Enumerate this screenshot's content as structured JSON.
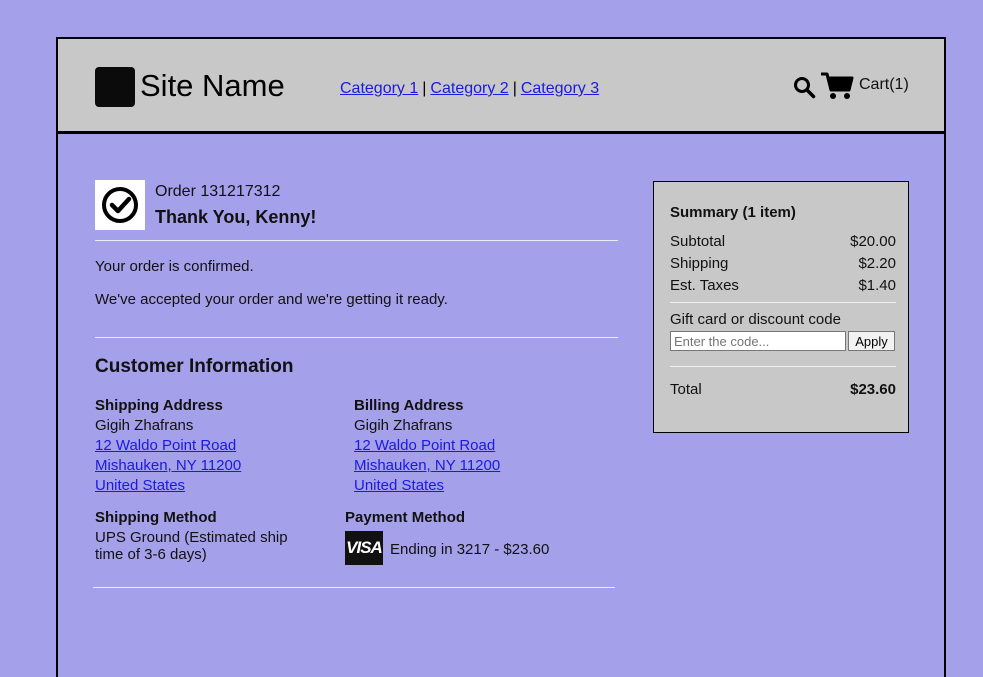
{
  "header": {
    "site_name": "Site Name",
    "nav": [
      "Category 1",
      "Category 2",
      "Category 3"
    ],
    "nav_separator": "|",
    "cart_label": "Cart(1)"
  },
  "order": {
    "number_label": "Order 131217312",
    "thanks": "Thank You, Kenny!",
    "confirmed": "Your order is confirmed.",
    "message": "We've accepted your order and we're getting it ready."
  },
  "customer": {
    "title": "Customer Information",
    "shipping_address": {
      "heading": "Shipping Address",
      "name": "Gigih Zhafrans",
      "street": "12 Waldo Point Road",
      "city": "Mishauken, NY 11200",
      "country": "United States"
    },
    "billing_address": {
      "heading": "Billing Address",
      "name": "Gigih Zhafrans",
      "street": "12 Waldo Point Road",
      "city": "Mishauken, NY 11200",
      "country": "United States"
    },
    "shipping_method": {
      "heading": "Shipping Method",
      "value": "UPS Ground (Estimated ship time of 3-6 days)"
    },
    "payment_method": {
      "heading": "Payment Method",
      "card_brand": "VISA",
      "value": "Ending in 3217 - $23.60"
    }
  },
  "summary": {
    "title": "Summary (1 item)",
    "subtotal_label": "Subtotal",
    "subtotal": "$20.00",
    "shipping_label": "Shipping",
    "shipping": "$2.20",
    "taxes_label": "Est. Taxes",
    "taxes": "$1.40",
    "gift_label": "Gift card or discount code",
    "code_placeholder": "Enter the code...",
    "apply_label": "Apply",
    "total_label": "Total",
    "total": "$23.60"
  },
  "colors": {
    "background": "#a5a0ea",
    "panel": "#c8c8c8",
    "link": "#1a1ae0"
  }
}
